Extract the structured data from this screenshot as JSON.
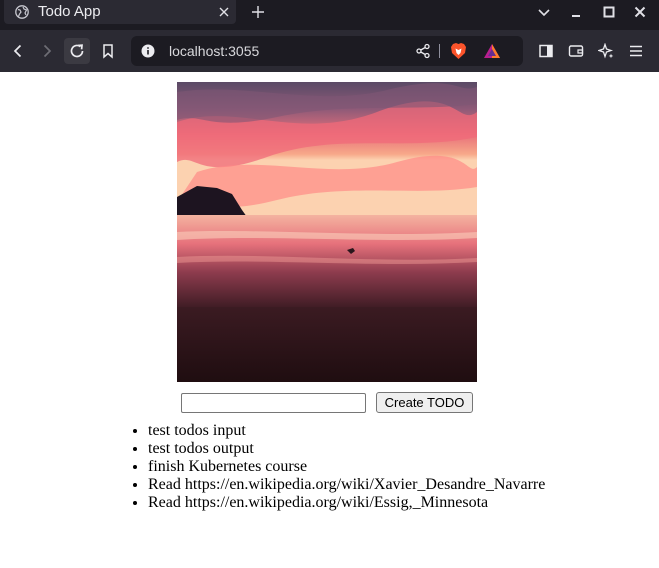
{
  "browser": {
    "tab": {
      "title": "Todo App"
    },
    "url": "localhost:3055",
    "icons": {
      "tab_favicon": "globe-icon",
      "tab_close": "close-icon",
      "new_tab": "plus-icon",
      "minimize": "minimize-icon",
      "maximize": "maximize-icon",
      "close_window": "close-icon",
      "tab_list": "chevron-down-icon",
      "back": "back-arrow-icon",
      "forward": "forward-arrow-icon",
      "reload": "reload-icon",
      "bookmark": "bookmark-icon",
      "site_info": "info-icon",
      "share": "share-icon",
      "brave_shields": "brave-lion-icon",
      "rewards": "triangle-rewards-icon",
      "sidebar": "sidebar-icon",
      "wallet": "wallet-icon",
      "leo": "sparkle-icon",
      "menu": "hamburger-menu-icon"
    }
  },
  "page": {
    "hero_image_alt": "sunset-beach-photo",
    "form": {
      "input_value": "",
      "button_label": "Create TODO"
    },
    "todos": [
      "test todos input",
      "test todos output",
      "finish Kubernetes course",
      "Read https://en.wikipedia.org/wiki/Xavier_Desandre_Navarre",
      "Read https://en.wikipedia.org/wiki/Essig,_Minnesota"
    ]
  },
  "colors": {
    "chrome_dark": "#1c1b22",
    "chrome_toolbar": "#2b2a33",
    "brave_orange": "#fb542b",
    "page_background": "#ffffff"
  }
}
